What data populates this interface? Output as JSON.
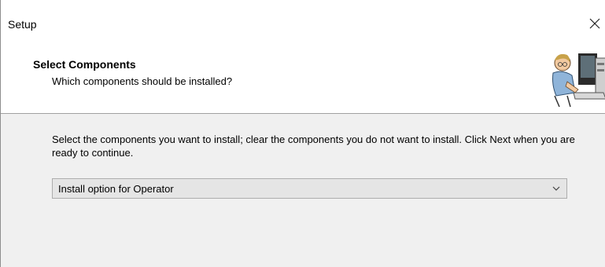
{
  "window": {
    "title": "Setup",
    "close_glyph": "✕"
  },
  "header": {
    "title": "Select Components",
    "subtitle": "Which components should be installed?",
    "image_icon": "wizard-computer-user-icon"
  },
  "body": {
    "instruction": "Select the components you want to install; clear the components you do not want to install. Click Next when you are ready to continue.",
    "install_type": {
      "selected": "Install option for Operator",
      "icon": "chevron-down-icon"
    }
  }
}
